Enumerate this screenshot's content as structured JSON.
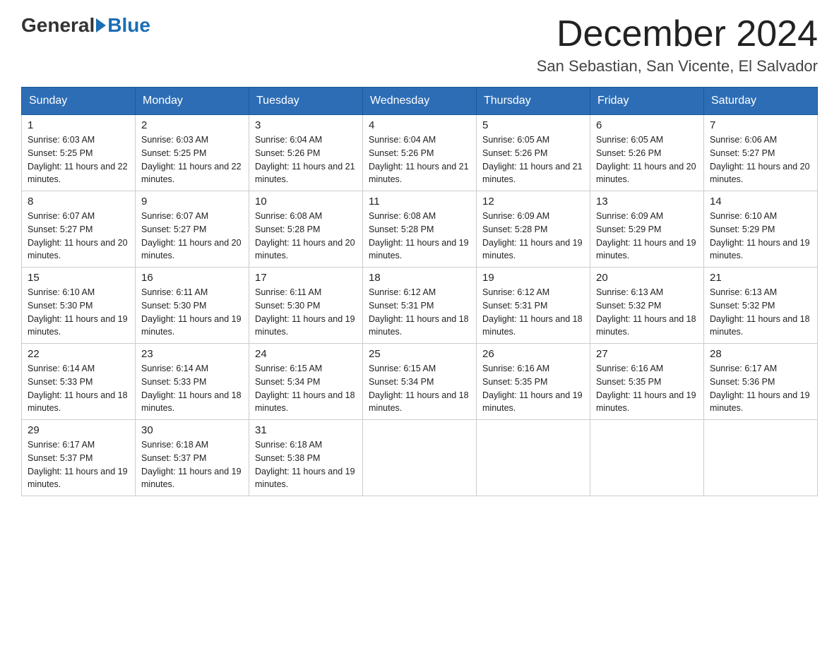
{
  "header": {
    "logo_general": "General",
    "logo_blue": "Blue",
    "month_title": "December 2024",
    "location": "San Sebastian, San Vicente, El Salvador"
  },
  "days_of_week": [
    "Sunday",
    "Monday",
    "Tuesday",
    "Wednesday",
    "Thursday",
    "Friday",
    "Saturday"
  ],
  "weeks": [
    [
      {
        "day": "1",
        "sunrise": "6:03 AM",
        "sunset": "5:25 PM",
        "daylight": "11 hours and 22 minutes."
      },
      {
        "day": "2",
        "sunrise": "6:03 AM",
        "sunset": "5:25 PM",
        "daylight": "11 hours and 22 minutes."
      },
      {
        "day": "3",
        "sunrise": "6:04 AM",
        "sunset": "5:26 PM",
        "daylight": "11 hours and 21 minutes."
      },
      {
        "day": "4",
        "sunrise": "6:04 AM",
        "sunset": "5:26 PM",
        "daylight": "11 hours and 21 minutes."
      },
      {
        "day": "5",
        "sunrise": "6:05 AM",
        "sunset": "5:26 PM",
        "daylight": "11 hours and 21 minutes."
      },
      {
        "day": "6",
        "sunrise": "6:05 AM",
        "sunset": "5:26 PM",
        "daylight": "11 hours and 20 minutes."
      },
      {
        "day": "7",
        "sunrise": "6:06 AM",
        "sunset": "5:27 PM",
        "daylight": "11 hours and 20 minutes."
      }
    ],
    [
      {
        "day": "8",
        "sunrise": "6:07 AM",
        "sunset": "5:27 PM",
        "daylight": "11 hours and 20 minutes."
      },
      {
        "day": "9",
        "sunrise": "6:07 AM",
        "sunset": "5:27 PM",
        "daylight": "11 hours and 20 minutes."
      },
      {
        "day": "10",
        "sunrise": "6:08 AM",
        "sunset": "5:28 PM",
        "daylight": "11 hours and 20 minutes."
      },
      {
        "day": "11",
        "sunrise": "6:08 AM",
        "sunset": "5:28 PM",
        "daylight": "11 hours and 19 minutes."
      },
      {
        "day": "12",
        "sunrise": "6:09 AM",
        "sunset": "5:28 PM",
        "daylight": "11 hours and 19 minutes."
      },
      {
        "day": "13",
        "sunrise": "6:09 AM",
        "sunset": "5:29 PM",
        "daylight": "11 hours and 19 minutes."
      },
      {
        "day": "14",
        "sunrise": "6:10 AM",
        "sunset": "5:29 PM",
        "daylight": "11 hours and 19 minutes."
      }
    ],
    [
      {
        "day": "15",
        "sunrise": "6:10 AM",
        "sunset": "5:30 PM",
        "daylight": "11 hours and 19 minutes."
      },
      {
        "day": "16",
        "sunrise": "6:11 AM",
        "sunset": "5:30 PM",
        "daylight": "11 hours and 19 minutes."
      },
      {
        "day": "17",
        "sunrise": "6:11 AM",
        "sunset": "5:30 PM",
        "daylight": "11 hours and 19 minutes."
      },
      {
        "day": "18",
        "sunrise": "6:12 AM",
        "sunset": "5:31 PM",
        "daylight": "11 hours and 18 minutes."
      },
      {
        "day": "19",
        "sunrise": "6:12 AM",
        "sunset": "5:31 PM",
        "daylight": "11 hours and 18 minutes."
      },
      {
        "day": "20",
        "sunrise": "6:13 AM",
        "sunset": "5:32 PM",
        "daylight": "11 hours and 18 minutes."
      },
      {
        "day": "21",
        "sunrise": "6:13 AM",
        "sunset": "5:32 PM",
        "daylight": "11 hours and 18 minutes."
      }
    ],
    [
      {
        "day": "22",
        "sunrise": "6:14 AM",
        "sunset": "5:33 PM",
        "daylight": "11 hours and 18 minutes."
      },
      {
        "day": "23",
        "sunrise": "6:14 AM",
        "sunset": "5:33 PM",
        "daylight": "11 hours and 18 minutes."
      },
      {
        "day": "24",
        "sunrise": "6:15 AM",
        "sunset": "5:34 PM",
        "daylight": "11 hours and 18 minutes."
      },
      {
        "day": "25",
        "sunrise": "6:15 AM",
        "sunset": "5:34 PM",
        "daylight": "11 hours and 18 minutes."
      },
      {
        "day": "26",
        "sunrise": "6:16 AM",
        "sunset": "5:35 PM",
        "daylight": "11 hours and 19 minutes."
      },
      {
        "day": "27",
        "sunrise": "6:16 AM",
        "sunset": "5:35 PM",
        "daylight": "11 hours and 19 minutes."
      },
      {
        "day": "28",
        "sunrise": "6:17 AM",
        "sunset": "5:36 PM",
        "daylight": "11 hours and 19 minutes."
      }
    ],
    [
      {
        "day": "29",
        "sunrise": "6:17 AM",
        "sunset": "5:37 PM",
        "daylight": "11 hours and 19 minutes."
      },
      {
        "day": "30",
        "sunrise": "6:18 AM",
        "sunset": "5:37 PM",
        "daylight": "11 hours and 19 minutes."
      },
      {
        "day": "31",
        "sunrise": "6:18 AM",
        "sunset": "5:38 PM",
        "daylight": "11 hours and 19 minutes."
      },
      null,
      null,
      null,
      null
    ]
  ]
}
